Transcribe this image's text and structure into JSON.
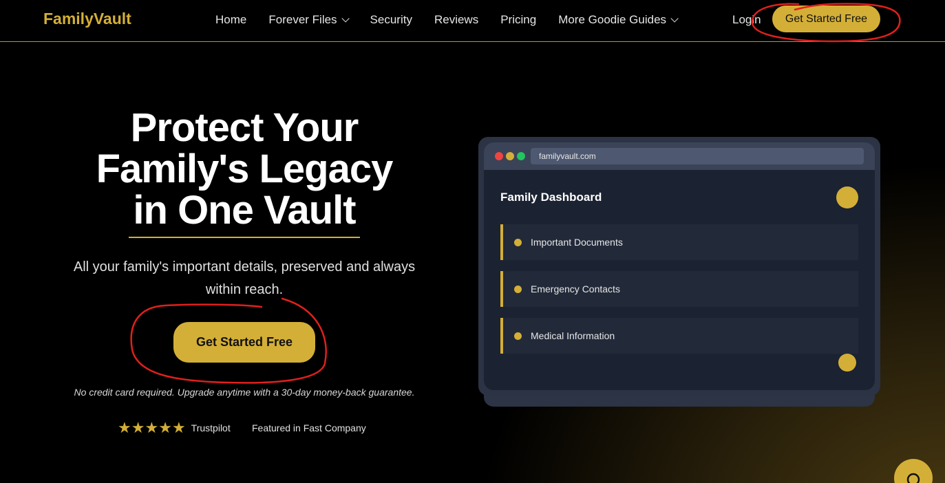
{
  "brand": {
    "name": "FamilyVault",
    "accent": "#d4af37"
  },
  "nav": {
    "links": [
      {
        "label": "Home",
        "dropdown": false
      },
      {
        "label": "Forever Files",
        "dropdown": true
      },
      {
        "label": "Security",
        "dropdown": false
      },
      {
        "label": "Reviews",
        "dropdown": false
      },
      {
        "label": "Pricing",
        "dropdown": false
      },
      {
        "label": "More Goodie Guides",
        "dropdown": true
      }
    ],
    "login": "Login",
    "cta": "Get Started Free"
  },
  "hero": {
    "title_line1": "Protect Your",
    "title_line2": "Family's Legacy",
    "title_line3": "in One Vault",
    "subtitle": "All your family's important details, preserved and always within reach.",
    "cta": "Get Started Free",
    "note": "No credit card required. Upgrade anytime with a 30-day money-back guarantee.",
    "rating_stars": 5,
    "trust_label": "Trustpilot",
    "featured": "Featured in Fast Company"
  },
  "mockup": {
    "url": "familyvault.com",
    "title": "Family Dashboard",
    "items": [
      "Important Documents",
      "Emergency Contacts",
      "Medical Information"
    ]
  },
  "annotations": {
    "circle_color": "#e0201c"
  },
  "chat": {
    "icon": "chat-search-icon"
  }
}
